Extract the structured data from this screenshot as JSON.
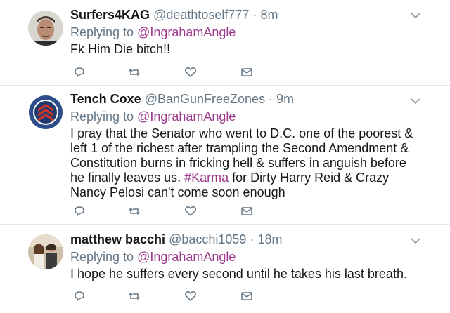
{
  "tweets": [
    {
      "display_name": "Surfers4KAG",
      "handle": "@deathtoself777",
      "separator": "·",
      "time": "8m",
      "replying_prefix": "Replying to",
      "replying_to": "@IngrahamAngle",
      "text": "Fk Him Die bitch!!",
      "avatar_icon": "profile-photo-man"
    },
    {
      "display_name": "Tench Coxe",
      "handle": "@BanGunFreeZones",
      "separator": "·",
      "time": "9m",
      "replying_prefix": "Replying to",
      "replying_to": "@IngrahamAngle",
      "text_lines": [
        "I pray that the Senator who went to D.C. one of the poorest &",
        "left 1 of the richest after trampling the Second Amendment &",
        "Constitution burns in fricking hell & suffers in anguish before"
      ],
      "text_line4_pre": "he finally leaves us. ",
      "hashtag": "#Karma",
      "text_line4_post": " for Dirty Harry Reid & Crazy",
      "text_line5": "Nancy Pelosi can't come soon enough",
      "avatar_icon": "sergeant-badge-emblem"
    },
    {
      "display_name": "matthew bacchi",
      "handle": "@bacchi1059",
      "separator": "·",
      "time": "18m",
      "replying_prefix": "Replying to",
      "replying_to": "@IngrahamAngle",
      "text": "I hope he suffers every second until he takes his last breath.",
      "avatar_icon": "group-photo"
    }
  ],
  "colors": {
    "mention": "#9b3a8c",
    "secondary_text": "#657786",
    "primary_text": "#14171a",
    "divider": "#e1e8ed"
  }
}
